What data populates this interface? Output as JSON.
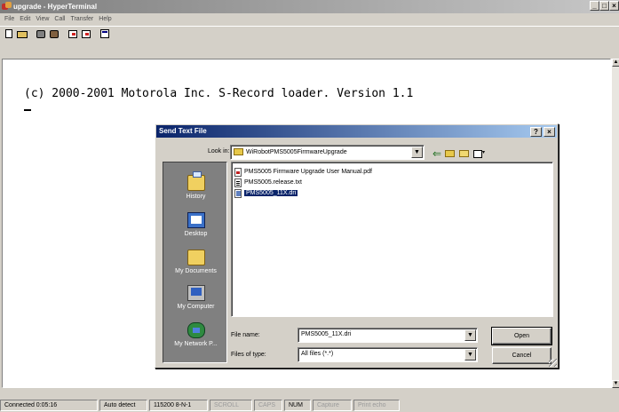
{
  "window": {
    "title": "upgrade - HyperTerminal",
    "controls": [
      "_",
      "□",
      "×"
    ]
  },
  "menu": [
    "File",
    "Edit",
    "View",
    "Call",
    "Transfer",
    "Help"
  ],
  "terminal": {
    "line1": "(c) 2000-2001 Motorola Inc. S-Record loader. Version 1.1"
  },
  "dialog": {
    "title": "Send Text File",
    "help_button": "?",
    "close_button": "×",
    "look_in_label": "Look in:",
    "look_in_value": "WiRobotPMS5005FirmwareUpgrade",
    "places": [
      "History",
      "Desktop",
      "My Documents",
      "My Computer",
      "My Network P..."
    ],
    "files": [
      {
        "name": "PMS5005 Firmware Upgrade User Manual.pdf",
        "icon": "pdf-file-icon",
        "selected": false
      },
      {
        "name": "PMS5005.release.txt",
        "icon": "text-file-icon",
        "selected": false
      },
      {
        "name": "PMS5005_11X.dri",
        "icon": "dri-file-icon",
        "selected": true
      }
    ],
    "file_name_label": "File name:",
    "file_name_value": "PMS5005_11X.dri",
    "file_type_label": "Files of type:",
    "file_type_value": "All files (*.*)",
    "open_label": "Open",
    "cancel_label": "Cancel"
  },
  "statusbar": {
    "connected": "Connected 0:05:16",
    "detect": "Auto detect",
    "settings": "115200 8-N-1",
    "scroll": "SCROLL",
    "caps": "CAPS",
    "num": "NUM",
    "capture": "Capture",
    "print_echo": "Print echo"
  },
  "colors": {
    "dialog_title_start": "#0a246a",
    "dialog_title_end": "#a6caf0",
    "selection": "#0a246a"
  }
}
